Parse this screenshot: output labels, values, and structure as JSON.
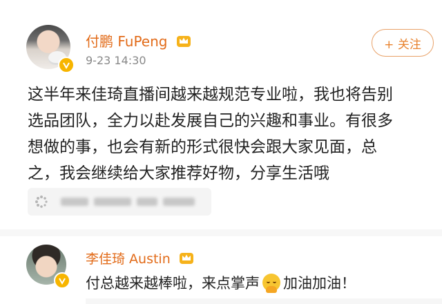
{
  "post": {
    "author_name": "付鹏 FuPeng",
    "time": "9-23 14:30",
    "follow_label": "+ 关注",
    "text_lines": [
      "这半年来佳琦直播间越来越规范专业啦，我也将告别",
      "选品团队，全力以赴发展自己的兴趣和事业。有很多",
      "想做的事，也会有新的形式很快会跟大家见面，总",
      "之，我会继续给大家推荐好物，分享生活哦"
    ]
  },
  "comment": {
    "author_name": "李佳琦 Austin",
    "text_before_emoji": "付总越来越棒啦，来点掌声",
    "text_after_emoji": "加油加油！"
  },
  "icons": {
    "verified": "verified-badge-icon",
    "crown": "vip-crown-icon",
    "link": "link-spinner-icon",
    "clap_emoji": "clapping-emoji-icon"
  },
  "colors": {
    "name": "#e26b19",
    "follow": "#e8822d",
    "badge": "#f7b500"
  }
}
